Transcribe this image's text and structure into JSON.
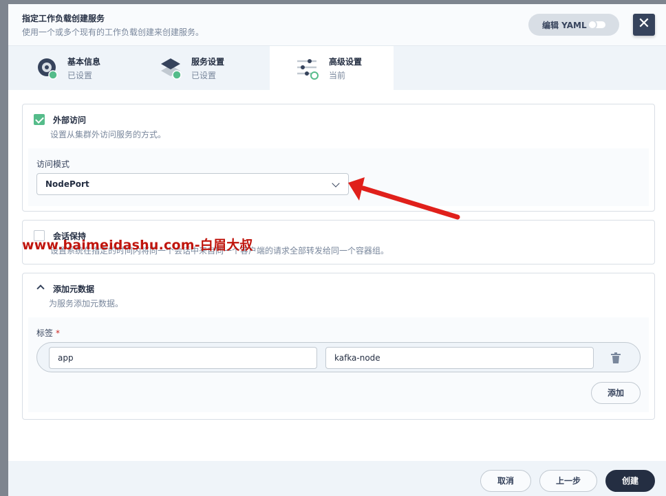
{
  "modal": {
    "title": "指定工作负载创建服务",
    "subtitle": "使用一个或多个现有的工作负载创建来创建服务。",
    "yaml_label": "编辑 YAML",
    "close_symbol": "✕"
  },
  "steps": [
    {
      "title": "基本信息",
      "status": "已设置",
      "icon": "disc-icon"
    },
    {
      "title": "服务设置",
      "status": "已设置",
      "icon": "layers-icon"
    },
    {
      "title": "高级设置",
      "status": "当前",
      "icon": "sliders-icon"
    }
  ],
  "external_access": {
    "checked": true,
    "title": "外部访问",
    "description": "设置从集群外访问服务的方式。",
    "mode_label": "访问模式",
    "mode_value": "NodePort"
  },
  "session_affinity": {
    "checked": false,
    "title": "会话保持",
    "description": "设置系统在指定的时间内将同一个会话中来自同一个客户端的请求全部转发给同一个容器组。"
  },
  "metadata": {
    "title": "添加元数据",
    "description": "为服务添加元数据。",
    "labels_label": "标签",
    "required_mark": "*",
    "labels": [
      {
        "key": "app",
        "value": "kafka-node"
      }
    ],
    "add_label": "添加"
  },
  "footer": {
    "cancel_label": "取消",
    "prev_label": "上一步",
    "create_label": "创建"
  },
  "watermark": "www.baimeidashu.com-白眉大叔",
  "colors": {
    "accent_green": "#55bc8a",
    "dark": "#242e42",
    "annotation_red": "#e0201b"
  }
}
